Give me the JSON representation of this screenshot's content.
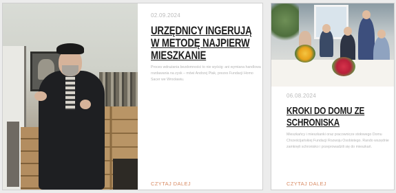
{
  "articles": [
    {
      "date": "02.09.2024",
      "title": "URZĘDNICY INGERUJĄ W METODĘ NAJPIERW MIESZKANIE",
      "excerpt": "Proces wdrażania bezdomności to nie wyścig: ani wymiana handlowa rozdawania na zysk – mówi Andrzej Ptak, prezes Fundacji Homo Sacer we Wrocławiu.",
      "read_more": "CZYTAJ DALEJ",
      "image_alt": "photo-man-speaking-in-workshop"
    },
    {
      "date": "06.08.2024",
      "title": "KROKI DO DOMU ZE SCHRONISKA",
      "excerpt": "Mieszkańcy i mieszkanki oraz pracownicze stołowego Domu Chrześcijańskiej Fundacji Rozwoju Osobistego. Rando wszędnie zamknęli schronisko i przeprowadzili się do mieszkań.",
      "read_more": "CZYTAJ DALEJ",
      "image_alt": "photo-group-at-festive-table"
    }
  ],
  "colors": {
    "accent": "#d88a62",
    "title": "#1d1d1d",
    "muted": "#b3b3b3",
    "background": "#ececec"
  }
}
